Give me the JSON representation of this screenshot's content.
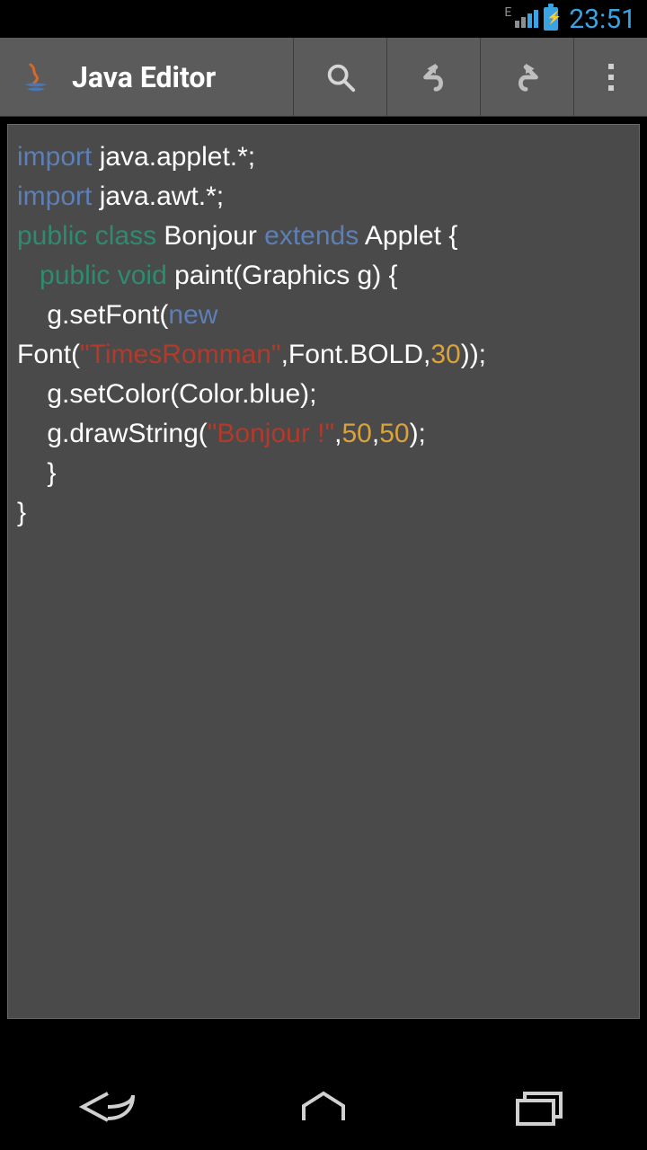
{
  "status": {
    "network_label": "E",
    "time": "23:51"
  },
  "actionbar": {
    "title": "Java Editor"
  },
  "syntax_colors": {
    "keyword": "#5c7fb8",
    "modifier": "#2e8b6f",
    "string": "#b33a2a",
    "number": "#d9a23b",
    "plain": "#ffffff"
  },
  "code": {
    "lines": [
      [
        {
          "t": "kw",
          "v": "import"
        },
        {
          "t": "plain",
          "v": " java.applet.*;"
        }
      ],
      [
        {
          "t": "kw",
          "v": "import"
        },
        {
          "t": "plain",
          "v": " java.awt.*;"
        }
      ],
      [
        {
          "t": "mod",
          "v": "public class"
        },
        {
          "t": "plain",
          "v": " Bonjour "
        },
        {
          "t": "kw",
          "v": "extends"
        },
        {
          "t": "plain",
          "v": " Applet {"
        }
      ],
      [
        {
          "t": "plain",
          "v": "   "
        },
        {
          "t": "mod",
          "v": "public void"
        },
        {
          "t": "plain",
          "v": " paint(Graphics g) {"
        }
      ],
      [
        {
          "t": "plain",
          "v": "    g.setFont("
        },
        {
          "t": "kw",
          "v": "new"
        },
        {
          "t": "plain",
          "v": " Font("
        },
        {
          "t": "str",
          "v": "\"TimesRomman\""
        },
        {
          "t": "plain",
          "v": ",Font.BOLD,"
        },
        {
          "t": "num",
          "v": "30"
        },
        {
          "t": "plain",
          "v": "));"
        }
      ],
      [
        {
          "t": "plain",
          "v": "    g.setColor(Color.blue);"
        }
      ],
      [
        {
          "t": "plain",
          "v": "    g.drawString("
        },
        {
          "t": "str",
          "v": "\"Bonjour !\""
        },
        {
          "t": "plain",
          "v": ","
        },
        {
          "t": "num",
          "v": "50"
        },
        {
          "t": "plain",
          "v": ","
        },
        {
          "t": "num",
          "v": "50"
        },
        {
          "t": "plain",
          "v": ");"
        }
      ],
      [
        {
          "t": "plain",
          "v": "    }"
        }
      ],
      [
        {
          "t": "plain",
          "v": "}"
        }
      ]
    ]
  }
}
